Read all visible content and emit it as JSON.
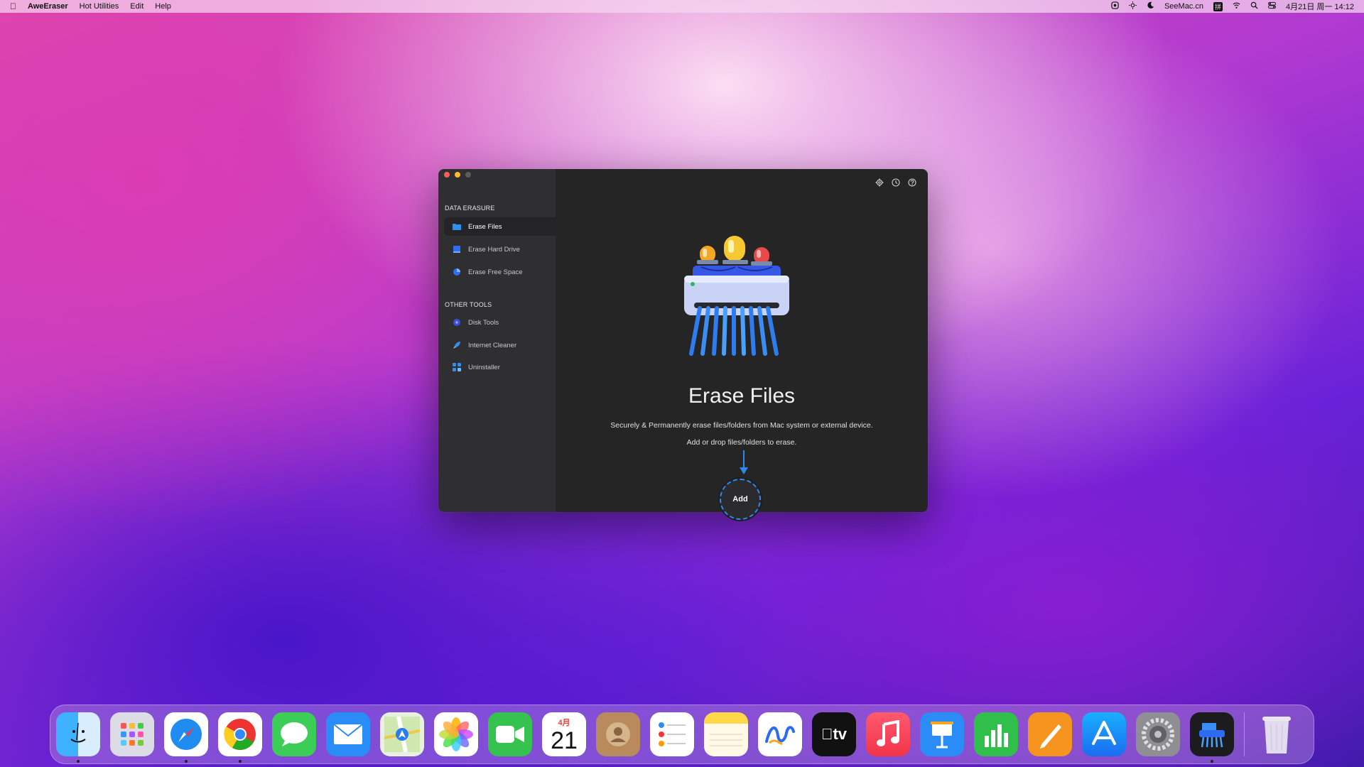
{
  "menubar": {
    "app_name": "AweEraser",
    "menus": [
      "Hot Utilities",
      "Edit",
      "Help"
    ],
    "site": "SeeMac.cn",
    "input_method": "拼",
    "clock": "4月21日 周一 14:12"
  },
  "sidebar": {
    "section1": "DATA ERASURE",
    "items1": [
      {
        "label": "Erase Files",
        "icon": "folder-icon"
      },
      {
        "label": "Erase Hard Drive",
        "icon": "hard-drive-icon"
      },
      {
        "label": "Erase Free Space",
        "icon": "pie-chart-icon"
      }
    ],
    "section2": "OTHER TOOLS",
    "items2": [
      {
        "label": "Disk Tools",
        "icon": "disk-icon"
      },
      {
        "label": "Internet Cleaner",
        "icon": "rocket-icon"
      },
      {
        "label": "Uninstaller",
        "icon": "grid-icon"
      }
    ]
  },
  "main": {
    "title": "Erase Files",
    "description": "Securely & Permanently erase files/folders from Mac system or external device.",
    "hint": "Add or drop files/folders to erase.",
    "add_label": "Add"
  },
  "dock": {
    "calendar_month": "4月",
    "calendar_day": "21",
    "tv_label": "tv"
  },
  "colors": {
    "accent": "#2a8cf0",
    "window_bg": "#252526",
    "sidebar_bg": "#2f2f31"
  }
}
